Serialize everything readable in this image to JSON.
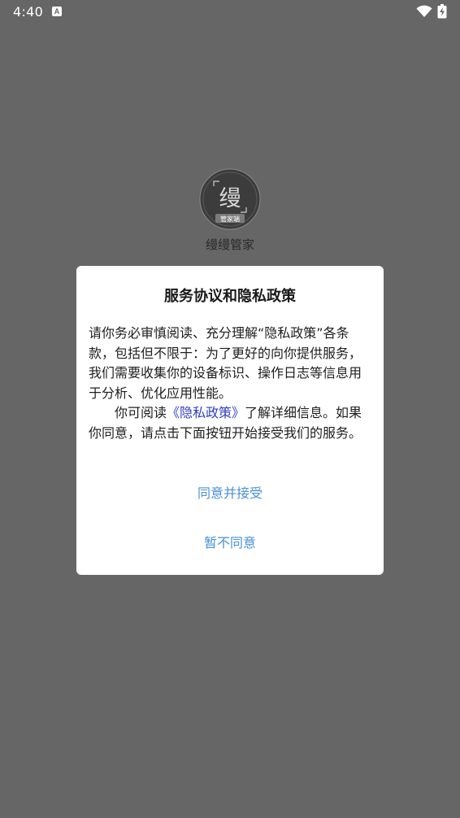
{
  "status_bar": {
    "time": "4:40",
    "notification_icon": "A"
  },
  "app": {
    "name": "缦缦管家",
    "logo_char": "缦",
    "logo_sub": "管家端"
  },
  "dialog": {
    "title": "服务协议和隐私政策",
    "paragraph1": "请你务必审慎阅读、充分理解“隐私政策”各条款，包括但不限于：为了更好的向你提供服务，我们需要收集你的设备标识、操作日志等信息用于分析、优化应用性能。",
    "paragraph2_prefix": "你可阅读",
    "policy_link": "《隐私政策》",
    "paragraph2_suffix": "了解详细信息。如果你同意，请点击下面按钮开始接受我们的服务。",
    "agree_label": "同意并接受",
    "disagree_label": "暂不同意"
  },
  "colors": {
    "overlay": "#666666",
    "dialog_bg": "#ffffff",
    "link": "#2f3fc2",
    "button_text": "#4a90d6"
  }
}
